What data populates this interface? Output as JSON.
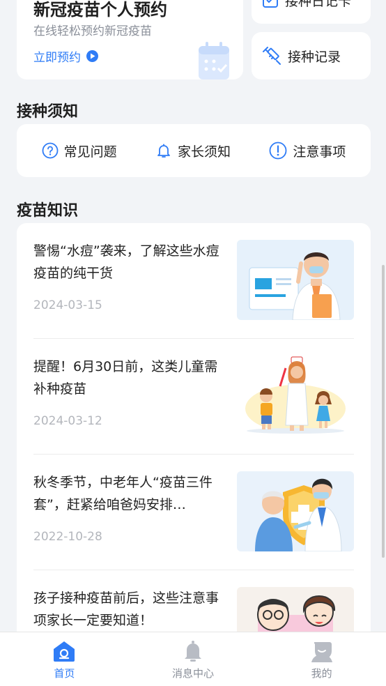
{
  "reserve": {
    "title": "新冠疫苗个人预约",
    "subtitle": "在线轻松预约新冠疫苗",
    "link": "立即预约"
  },
  "quick": {
    "diary": "接种日记卡",
    "record": "接种记录"
  },
  "notice": {
    "title": "接种须知",
    "items": [
      {
        "label": "常见问题",
        "icon": "question-icon"
      },
      {
        "label": "家长须知",
        "icon": "bell-icon"
      },
      {
        "label": "注意事项",
        "icon": "exclamation-icon"
      }
    ]
  },
  "knowledge": {
    "title": "疫苗知识",
    "articles": [
      {
        "title": "警惕“水痘”袭来，了解这些水痘疫苗的纯干货",
        "date": "2024-03-15"
      },
      {
        "title": "提醒！6月30日前，这类儿童需补种疫苗",
        "date": "2024-03-12"
      },
      {
        "title": "秋冬季节，中老年人“疫苗三件套”，赶紧给咱爸妈安排…",
        "date": "2022-10-28"
      },
      {
        "title": "孩子接种疫苗前后，这些注意事项家长一定要知道！",
        "date": ""
      }
    ]
  },
  "tabs": [
    {
      "label": "首页",
      "icon": "home-icon",
      "active": true
    },
    {
      "label": "消息中心",
      "icon": "bell-icon",
      "active": false
    },
    {
      "label": "我的",
      "icon": "user-icon",
      "active": false
    }
  ],
  "colors": {
    "accent": "#2f7cf6",
    "background": "#f2f4f7",
    "muted": "#8a8f99"
  }
}
